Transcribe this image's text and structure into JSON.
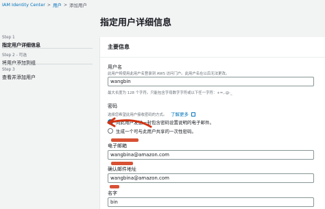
{
  "breadcrumb": {
    "items": [
      "IAM Identity Center",
      "用户",
      "添加用户"
    ]
  },
  "sidebar": {
    "steps": [
      {
        "num": "Step 1",
        "title": "指定用户详细信息"
      },
      {
        "num": "Step 2 - 可选",
        "title": "将用户添加到组"
      },
      {
        "num": "Step 3",
        "title": "查看并添加用户"
      }
    ]
  },
  "page": {
    "title": "指定用户详细信息"
  },
  "panel": {
    "header": "主要信息",
    "username": {
      "label": "用户名",
      "desc": "此用户将使用此用户名登录到 AWS 访问门户。此用户名在以后无法更改。",
      "value": "wangbin",
      "hint": "最大长度为 128 个字符。只能包含字母数字字符或以下任一字符：+=,.@-_"
    },
    "password": {
      "label": "密码",
      "desc": "选择您希望此用户接收密码的方式。",
      "learn_more": "了解更多",
      "options": [
        "向此用户发送一封包含密码设置说明的电子邮件。",
        "生成一个可与此用户共享的一次性密码。"
      ]
    },
    "email": {
      "label": "电子邮箱",
      "value": "wangbina@amazon.com"
    },
    "confirm_email": {
      "label": "确认邮件地址",
      "value": "wangbina@amazon.com"
    },
    "name": {
      "label": "名字",
      "value": "bin"
    }
  },
  "colors": {
    "accent": "#0073bb",
    "annotation": "#d13212"
  }
}
